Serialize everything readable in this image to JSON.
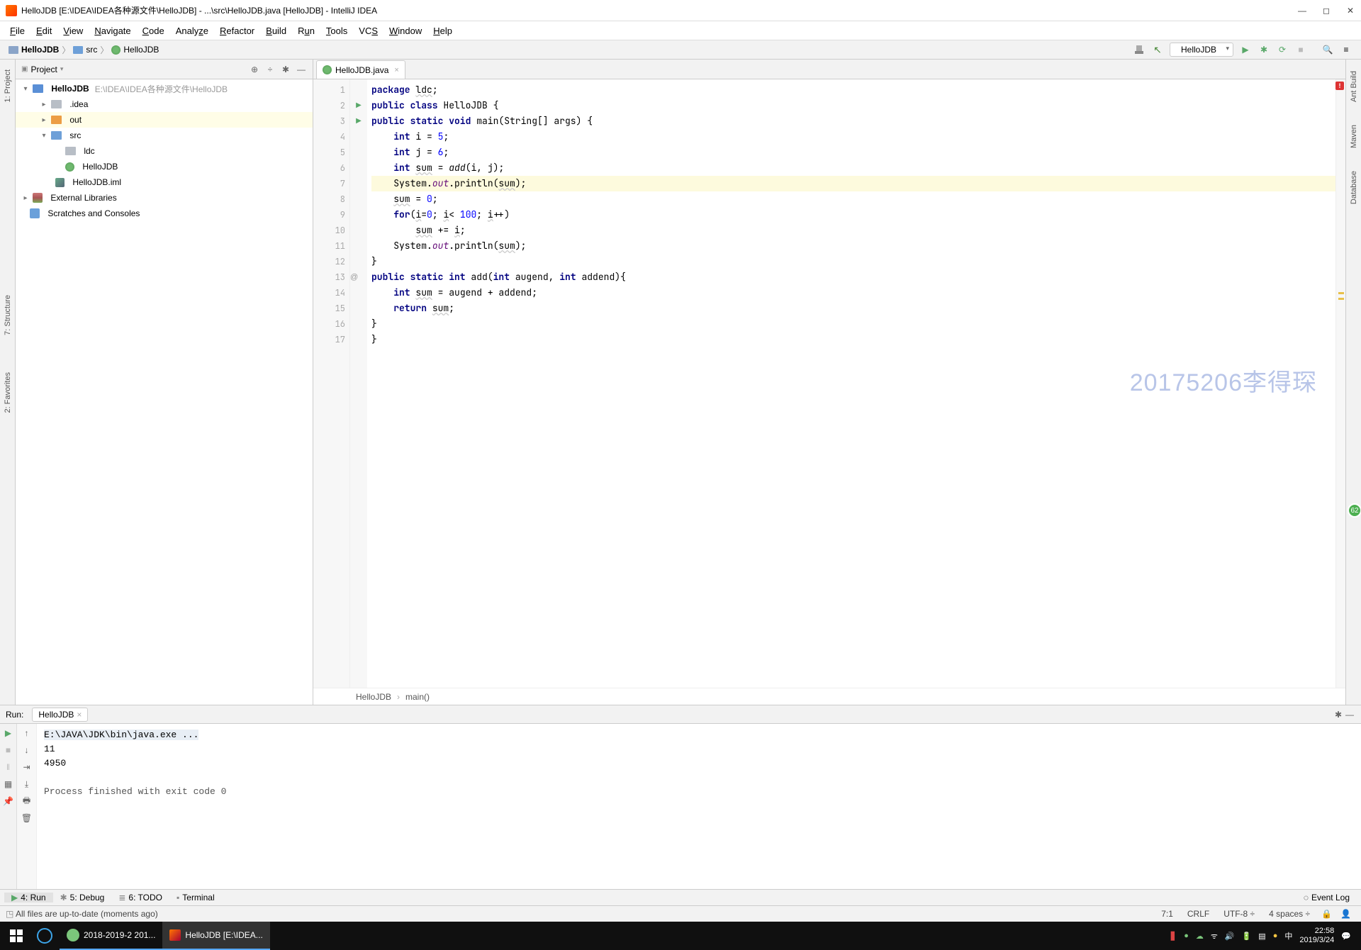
{
  "title": "HelloJDB [E:\\IDEA\\IDEA各种源文件\\HelloJDB] - ...\\src\\HelloJDB.java [HelloJDB] - IntelliJ IDEA",
  "menu": [
    "File",
    "Edit",
    "View",
    "Navigate",
    "Code",
    "Analyze",
    "Refactor",
    "Build",
    "Run",
    "Tools",
    "VCS",
    "Window",
    "Help"
  ],
  "breadcrumbs": [
    {
      "icon": "folder",
      "label": "HelloJDB"
    },
    {
      "icon": "folder",
      "label": "src"
    },
    {
      "icon": "java",
      "label": "HelloJDB"
    }
  ],
  "runConfig": "HelloJDB",
  "projectHeader": "Project",
  "tree": {
    "root": {
      "name": "HelloJDB",
      "path": "E:\\IDEA\\IDEA各种源文件\\HelloJDB"
    },
    "idea": ".idea",
    "out": "out",
    "src": "src",
    "ldc": "ldc",
    "hello": "HelloJDB",
    "iml": "HelloJDB.iml",
    "extlib": "External Libraries",
    "scratch": "Scratches and Consoles"
  },
  "tab": "HelloJDB.java",
  "lineNumbers": [
    "1",
    "2",
    "3",
    "4",
    "5",
    "6",
    "7",
    "8",
    "9",
    "10",
    "11",
    "12",
    "13",
    "14",
    "15",
    "16",
    "17"
  ],
  "crumbs": {
    "cls": "HelloJDB",
    "mtd": "main()",
    "sep": "›"
  },
  "runPanel": {
    "label": "Run:",
    "tab": "HelloJDB"
  },
  "console": {
    "cmd": "E:\\JAVA\\JDK\\bin\\java.exe ...",
    "l1": "11",
    "l2": "4950",
    "exit": "Process finished with exit code 0"
  },
  "bottomTools": {
    "run": "4: Run",
    "debug": "5: Debug",
    "todo": "6: TODO",
    "terminal": "Terminal",
    "eventlog": "Event Log"
  },
  "status": {
    "msg": "All files are up-to-date (moments ago)",
    "pos": "7:1",
    "eol": "CRLF",
    "enc": "UTF-8",
    "indent": "4 spaces"
  },
  "rails": {
    "project": "1: Project",
    "structure": "7: Structure",
    "favorites": "2: Favorites",
    "antbuild": "Ant Build",
    "maven": "Maven",
    "database": "Database"
  },
  "taskbar": {
    "t1": "2018-2019-2 201...",
    "t2": "HelloJDB [E:\\IDEA...",
    "time": "22:58",
    "date": "2019/3/24",
    "ime": "中"
  },
  "watermark": "20175206李得琛",
  "badge62": "62"
}
